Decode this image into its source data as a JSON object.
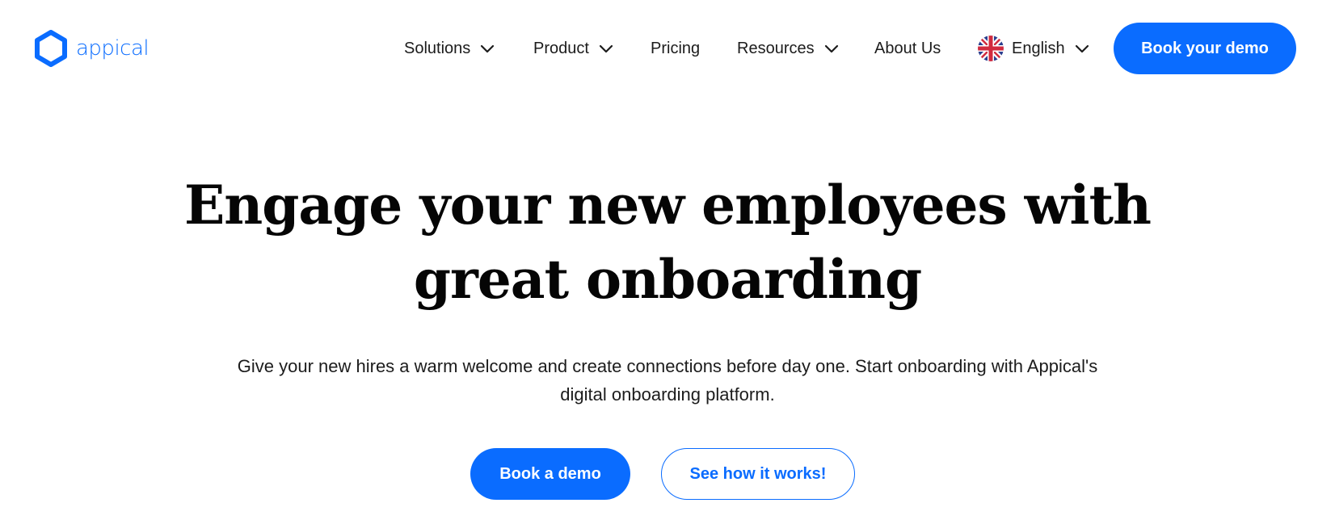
{
  "brand": {
    "name": "appical",
    "accent_color": "#0a6cff",
    "logo_icon": "hexagon-logo-icon"
  },
  "nav": {
    "items": [
      {
        "label": "Solutions",
        "has_dropdown": true,
        "icon": "chevron-down-icon"
      },
      {
        "label": "Product",
        "has_dropdown": true,
        "icon": "chevron-down-icon"
      },
      {
        "label": "Pricing",
        "has_dropdown": false
      },
      {
        "label": "Resources",
        "has_dropdown": true,
        "icon": "chevron-down-icon"
      },
      {
        "label": "About Us",
        "has_dropdown": false
      }
    ],
    "language": {
      "label": "English",
      "flag_icon": "uk-flag-icon",
      "has_dropdown": true
    },
    "cta_label": "Book your demo"
  },
  "hero": {
    "title_line1": "Engage your new employees with",
    "title_line2": "great onboarding",
    "subtitle_line1": "Give your new hires a warm welcome and create connections before day one. Start onboarding with Appical's",
    "subtitle_line2": "digital onboarding platform.",
    "primary_cta": "Book a demo",
    "secondary_cta": "See how it works!"
  }
}
